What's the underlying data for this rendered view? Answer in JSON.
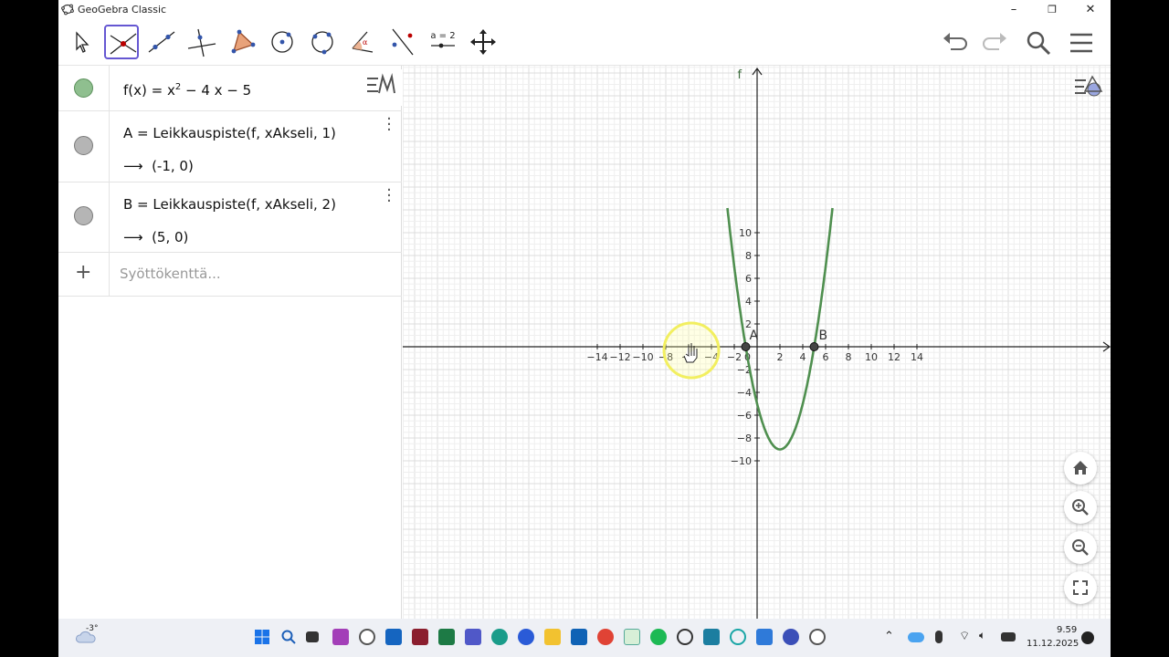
{
  "window": {
    "title": "GeoGebra Classic",
    "minimize": "–",
    "maximize": "❐",
    "close": "✕"
  },
  "toolbar": {
    "tools": [
      {
        "name": "move-tool-icon"
      },
      {
        "name": "intersect-tool-icon",
        "selected": true
      },
      {
        "name": "line-tool-icon"
      },
      {
        "name": "perpendicular-line-tool-icon"
      },
      {
        "name": "polygon-tool-icon"
      },
      {
        "name": "circle-center-point-tool-icon"
      },
      {
        "name": "circle-three-points-tool-icon"
      },
      {
        "name": "angle-tool-icon"
      },
      {
        "name": "reflect-tool-icon"
      },
      {
        "name": "slider-tool-icon",
        "label": "a = 2"
      },
      {
        "name": "move-graphics-view-tool-icon"
      }
    ],
    "undo_icon": "undo-icon",
    "redo_icon": "redo-icon",
    "search_icon": "search-icon",
    "menu_icon": "menu-icon"
  },
  "algebra": {
    "rows": [
      {
        "expr_prefix": "f(x)  =  x",
        "expr_sup": "2",
        "expr_suffix": " − 4 x − 5",
        "color": "#8fbf8f"
      },
      {
        "expr": "A  =  Leikkauspiste(f, xAkseli, 1)",
        "output": "(-1, 0)",
        "color": "#b5b5b5"
      },
      {
        "expr": "B  =  Leikkauspiste(f, xAkseli, 2)",
        "output": "(5, 0)",
        "color": "#b5b5b5"
      }
    ],
    "arrow": "⟶",
    "input_placeholder": "Syöttökenttä...",
    "plus": "+"
  },
  "graphics": {
    "function_label": "f",
    "point_A_label": "A",
    "point_B_label": "B",
    "origin_label": "0",
    "x_ticks": [
      "−14",
      "−12",
      "−10",
      "−8",
      "−6",
      "−4",
      "−2",
      "2",
      "4",
      "6",
      "8",
      "10",
      "12",
      "14"
    ],
    "y_ticks": [
      "10",
      "8",
      "6",
      "4",
      "2",
      "−2",
      "−4",
      "−6",
      "−8",
      "−10"
    ],
    "curve_color": "#4f8f4f"
  },
  "taskbar": {
    "weather": "-3°",
    "time": "9.59",
    "date": "11.12.2025"
  }
}
